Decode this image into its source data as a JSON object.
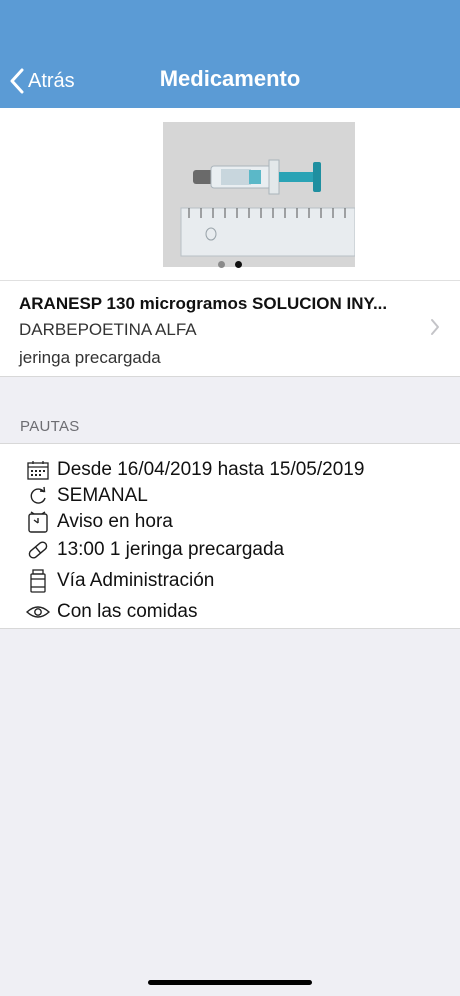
{
  "nav": {
    "back_label": "Atrás",
    "title": "Medicamento",
    "background": "#5b9bd5"
  },
  "gallery": {
    "image": "syringe-with-ruler-photo",
    "page_count": 2,
    "active_page": 2
  },
  "medication": {
    "name": "ARANESP 130 microgramos SOLUCION INY...",
    "active_ingredient": "DARBEPOETINA ALFA",
    "form": "jeringa precargada"
  },
  "section": {
    "title": "PAUTAS"
  },
  "pautas": [
    {
      "icon": "calendar-icon",
      "text": "Desde 16/04/2019 hasta 15/05/2019"
    },
    {
      "icon": "repeat-icon",
      "text": "SEMANAL"
    },
    {
      "icon": "alarm-clock-icon",
      "text": "Aviso en hora"
    },
    {
      "icon": "pill-icon",
      "text": "13:00 1 jeringa precargada"
    },
    {
      "icon": "medicine-bottle-icon",
      "text": "Vía Administración"
    },
    {
      "icon": "eye-icon",
      "text": "Con las comidas"
    }
  ]
}
